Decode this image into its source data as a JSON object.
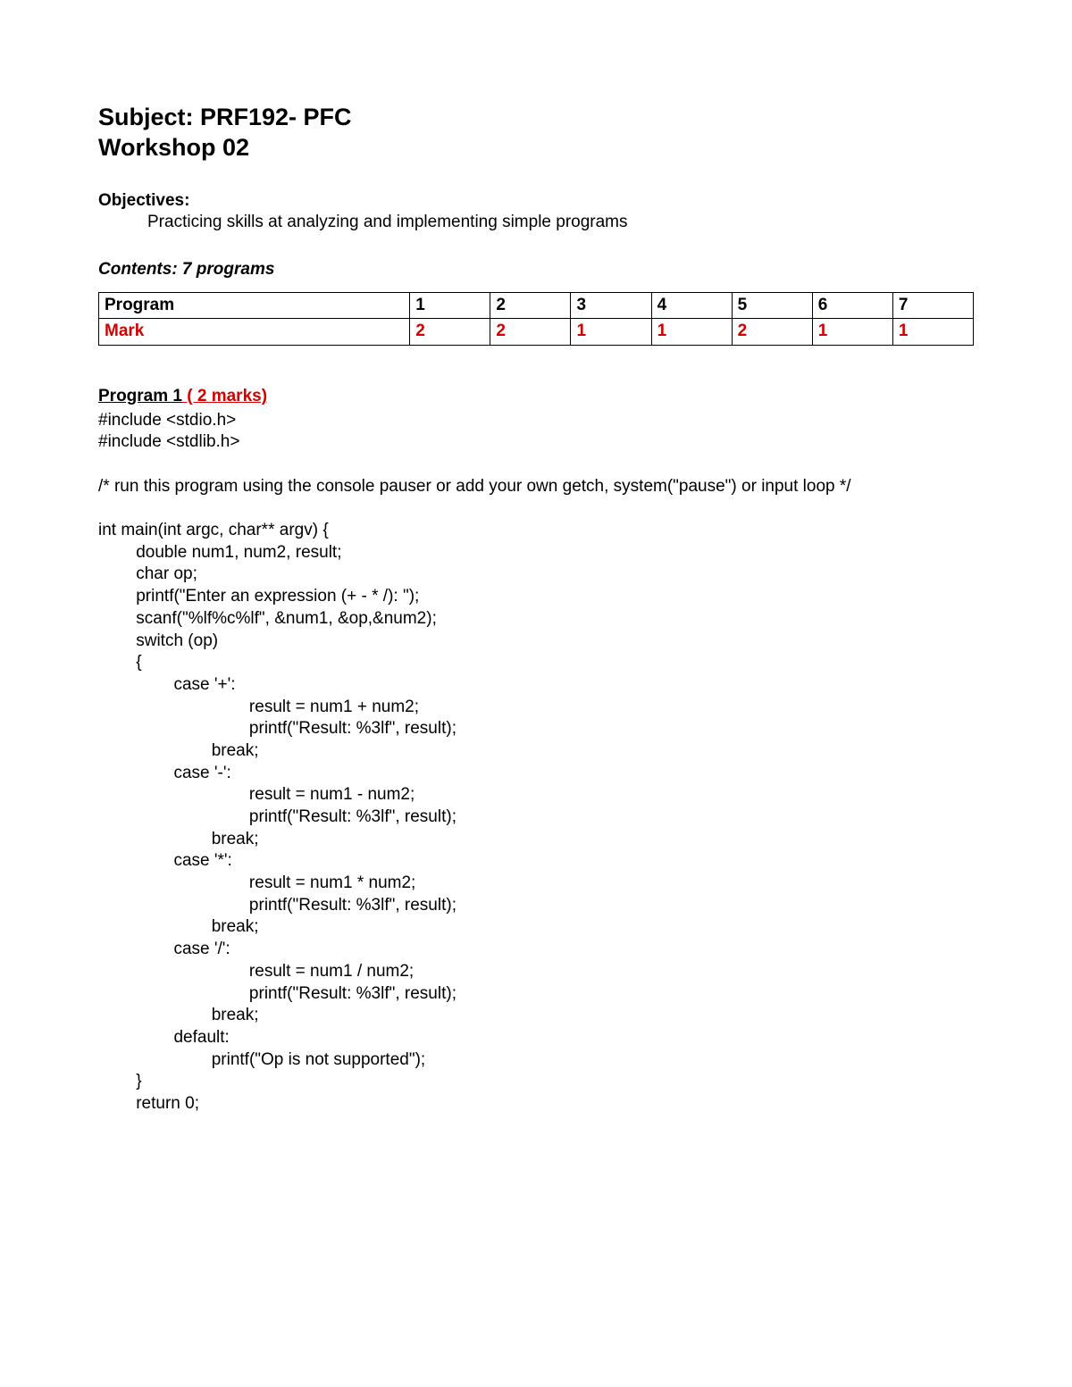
{
  "title_line1": "Subject: PRF192- PFC",
  "title_line2": "Workshop 02",
  "objectives_label": "Objectives:",
  "objectives_text": "Practicing skills at analyzing and implementing simple programs",
  "contents_label": "Contents: 7 programs",
  "table": {
    "header": [
      "Program",
      "1",
      "2",
      "3",
      "4",
      "5",
      "6",
      "7"
    ],
    "mark_label": "Mark",
    "marks": [
      "2",
      "2",
      "1",
      "1",
      "2",
      "1",
      "1"
    ]
  },
  "program1": {
    "label": "Program 1",
    "marks": " ( 2 marks)"
  },
  "code_lines": [
    "#include <stdio.h>",
    "#include <stdlib.h>",
    "",
    "/* run this program using the console pauser or add your own getch, system(\"pause\") or input loop */",
    "",
    "int main(int argc, char** argv) {",
    "\tdouble num1, num2, result;",
    "\tchar op;",
    "\tprintf(\"Enter an expression (+ - * /): \");",
    "\tscanf(\"%lf%c%lf\", &num1, &op,&num2);",
    "\tswitch (op)",
    "\t{",
    "\t\tcase '+':",
    "\t\t\t\tresult = num1 + num2;",
    "\t\t\t\tprintf(\"Result: %3lf\", result);",
    "\t\t\tbreak;",
    "\t\tcase '-':",
    "\t\t\t\tresult = num1 - num2;",
    "\t\t\t\tprintf(\"Result: %3lf\", result);",
    "\t\t\tbreak;",
    "\t\tcase '*':",
    "\t\t\t\tresult = num1 * num2;",
    "\t\t\t\tprintf(\"Result: %3lf\", result);",
    "\t\t\tbreak;",
    "\t\tcase '/':",
    "\t\t\t\tresult = num1 / num2;",
    "\t\t\t\tprintf(\"Result: %3lf\", result);",
    "\t\t\tbreak;",
    "\t\tdefault:",
    "\t\t\tprintf(\"Op is not supported\");",
    "\t}",
    "\treturn 0;"
  ]
}
